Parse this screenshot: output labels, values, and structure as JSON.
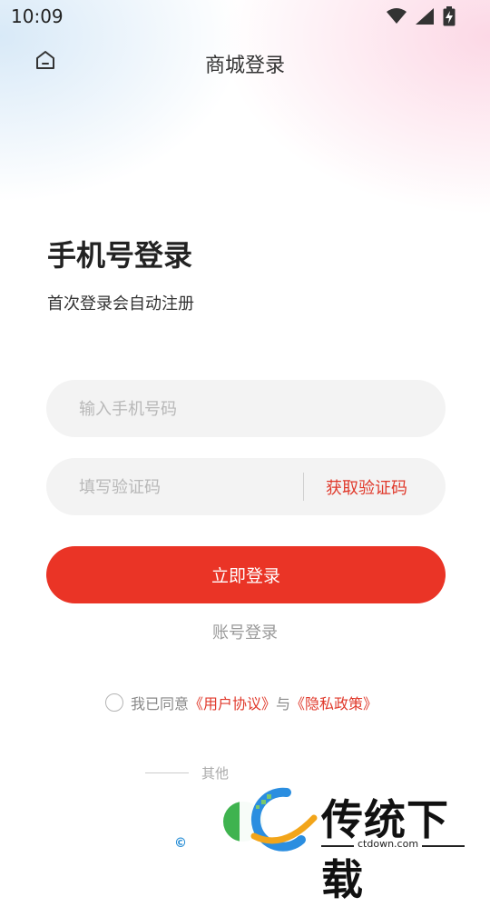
{
  "status_bar": {
    "time": "10:09",
    "icons": [
      "wifi-icon",
      "signal-icon",
      "battery-charging-icon"
    ]
  },
  "header": {
    "title": "商城登录",
    "home_icon": "home-icon"
  },
  "login": {
    "heading": "手机号登录",
    "subheading": "首次登录会自动注册",
    "phone_placeholder": "输入手机号码",
    "code_placeholder": "填写验证码",
    "get_code_label": "获取验证码",
    "submit_label": "立即登录",
    "account_login_label": "账号登录"
  },
  "agreement": {
    "prefix": "我已同意",
    "user_agreement": "《用户协议》",
    "joiner": "与",
    "privacy_policy": "《隐私政策》"
  },
  "other_login": {
    "label": "其他"
  },
  "watermark": {
    "brand": "传统下载",
    "url": "ctdown.com"
  },
  "colors": {
    "accent": "#ea3426",
    "link": "#e0392b"
  }
}
